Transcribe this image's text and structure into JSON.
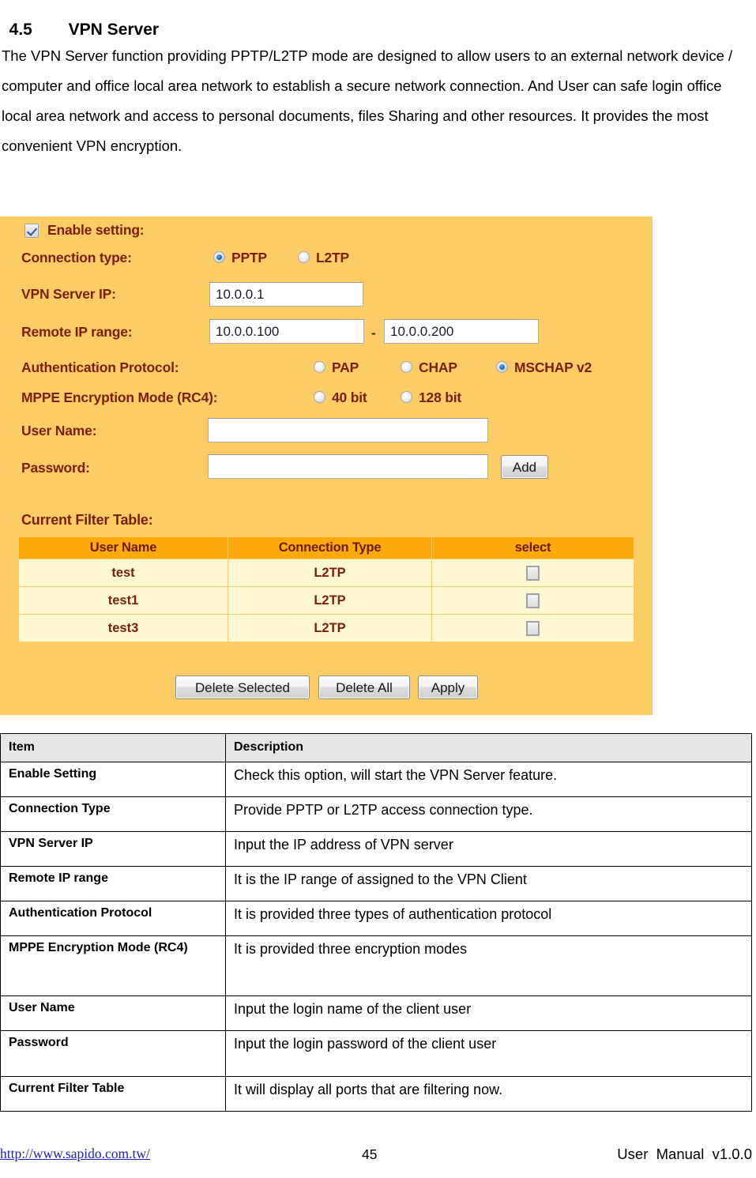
{
  "heading": {
    "number": "4.5",
    "title": "VPN Server"
  },
  "intro": {
    "paragraph_1": "The VPN Server function providing PPTP/L2TP mode are designed to allow users to an external network device / computer and office local area network to establish a secure network connection. And User can safe login office local area network and access to personal documents, files Sharing and other resources. It provides the most convenient VPN encryption."
  },
  "panel": {
    "background_color": "#fccc66",
    "enable_setting": {
      "label": "Enable setting:",
      "checked": true
    },
    "connection_type": {
      "label": "Connection type:",
      "options": [
        "PPTP",
        "L2TP"
      ],
      "selected": "PPTP"
    },
    "vpn_server_ip": {
      "label": "VPN Server IP:",
      "value": "10.0.0.1"
    },
    "remote_ip_range": {
      "label": "Remote IP range:",
      "separator": "-",
      "start": "10.0.0.100",
      "end": "10.0.0.200"
    },
    "authentication_protocol": {
      "label": "Authentication Protocol:",
      "options": [
        "PAP",
        "CHAP",
        "MSCHAP v2"
      ],
      "selected": "MSCHAP v2"
    },
    "mppe_encryption_mode": {
      "label": "MPPE Encryption Mode (RC4):",
      "options": [
        "40 bit",
        "128 bit"
      ],
      "selected": ""
    },
    "user_name": {
      "label": "User Name:",
      "value": "",
      "placeholder": ""
    },
    "password": {
      "label": "Password:",
      "value": "",
      "placeholder": ""
    },
    "add_button": "Add",
    "filter_table": {
      "caption": "Current Filter Table:",
      "header_color": "#fca90d",
      "row_color": "#fdf7d2",
      "columns": [
        "User Name",
        "Connection Type",
        "select"
      ],
      "rows": [
        {
          "user_name": "test",
          "connection_type": "L2TP",
          "selected": false
        },
        {
          "user_name": "test1",
          "connection_type": "L2TP",
          "selected": false
        },
        {
          "user_name": "test3",
          "connection_type": "L2TP",
          "selected": false
        }
      ]
    },
    "actions": {
      "delete_selected": "Delete Selected",
      "delete_all": "Delete All",
      "apply": "Apply"
    }
  },
  "description_table": {
    "headers": [
      "Item",
      "Description"
    ],
    "rows": [
      {
        "item": "Enable Setting",
        "description": "Check this option, will start the VPN Server feature."
      },
      {
        "item": "Connection Type",
        "description": "Provide PPTP or L2TP access connection type."
      },
      {
        "item": "VPN Server IP",
        "description": "Input the IP address of VPN server"
      },
      {
        "item": "Remote IP range",
        "description": "It is the IP range of assigned to the VPN Client"
      },
      {
        "item": "Authentication Protocol",
        "description": "It is provided three types of authentication protocol"
      },
      {
        "item": "MPPE Encryption Mode (RC4)",
        "description": "It is provided three encryption modes"
      },
      {
        "item": "User Name",
        "description": "Input the login name of the client user"
      },
      {
        "item": "Password",
        "description": "Input the login password of the client user"
      },
      {
        "item": "Current Filter Table",
        "description": "It will display all ports that are filtering now."
      }
    ]
  },
  "footer": {
    "url": "http://www.sapido.com.tw/",
    "page_number": "45",
    "manual": "User  Manual  v1.0.0"
  }
}
